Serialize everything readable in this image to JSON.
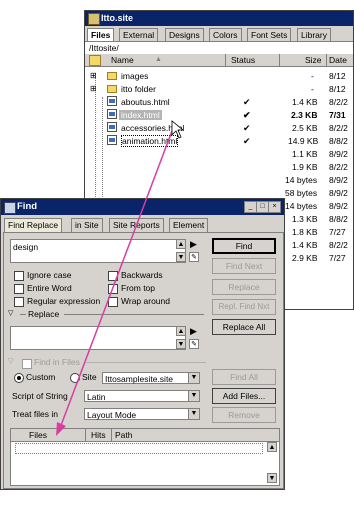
{
  "site_window": {
    "title": "Itto.site",
    "tabs": [
      "Files",
      "External",
      "Designs",
      "Colors",
      "Font Sets",
      "Library"
    ],
    "path": "/Ittosite/",
    "columns": {
      "name": "Name",
      "status": "Status",
      "size": "Size",
      "date": "Date"
    },
    "rows": [
      {
        "name": "images",
        "type": "folder",
        "status": "",
        "size": "-",
        "date": "8/12"
      },
      {
        "name": "itto folder",
        "type": "folder",
        "status": "",
        "size": "-",
        "date": "8/12"
      },
      {
        "name": "aboutus.html",
        "type": "html",
        "status": "✔",
        "size": "1.4 KB",
        "date": "8/2/2"
      },
      {
        "name": "index.html",
        "type": "html",
        "status": "✔",
        "size": "2.3 KB",
        "date": "7/31"
      },
      {
        "name": "accessories.html",
        "type": "html",
        "status": "✔",
        "size": "2.5 KB",
        "date": "8/2/2"
      },
      {
        "name": "animation.html",
        "type": "html",
        "status": "✔",
        "size": "14.9 KB",
        "date": "8/8/2"
      },
      {
        "name": "",
        "type": "",
        "status": "",
        "size": "1.1 KB",
        "date": "8/9/2"
      },
      {
        "name": "",
        "type": "",
        "status": "",
        "size": "1.9 KB",
        "date": "8/2/2"
      },
      {
        "name": "",
        "type": "",
        "status": "",
        "size": "14 bytes",
        "date": "8/9/2"
      },
      {
        "name": "",
        "type": "",
        "status": "",
        "size": "58 bytes",
        "date": "8/9/2"
      },
      {
        "name": "",
        "type": "",
        "status": "",
        "size": "14 bytes",
        "date": "8/9/2"
      },
      {
        "name": "",
        "type": "",
        "status": "",
        "size": "1.3 KB",
        "date": "8/8/2"
      },
      {
        "name": "",
        "type": "",
        "status": "",
        "size": "1.8 KB",
        "date": "7/27"
      },
      {
        "name": "",
        "type": "",
        "status": "",
        "size": "1.4 KB",
        "date": "8/2/2"
      },
      {
        "name": "",
        "type": "",
        "status": "",
        "size": "2.9 KB",
        "date": "7/27"
      }
    ]
  },
  "find_dialog": {
    "title": "Find",
    "tabs": [
      "Find Replace",
      "in Site",
      "Site Reports",
      "Element"
    ],
    "find_value": "design",
    "buttons": {
      "find": "Find",
      "find_next": "Find Next",
      "replace": "Replace",
      "repl_find_nxt": "Repl. Find Nxt",
      "replace_all": "Replace All",
      "find_all": "Find All",
      "add_files": "Add Files...",
      "remove": "Remove"
    },
    "options": {
      "ignore_case": "Ignore case",
      "backwards": "Backwards",
      "entire_word": "Entire Word",
      "from_top": "From top",
      "regular_expression": "Regular expression",
      "wrap_around": "Wrap around"
    },
    "replace_label": "Replace",
    "find_in_files_label": "Find in Files",
    "scope": {
      "custom": "Custom",
      "site": "Site",
      "site_value": "Ittosamplesite.site"
    },
    "script_label": "Script of String",
    "script_value": "Latin",
    "treat_label": "Treat files in",
    "treat_value": "Layout Mode",
    "results_columns": {
      "files": "Files",
      "hits": "Hits",
      "path": "Path"
    }
  },
  "colors": {
    "title_bar": "#0a246a",
    "window_bg": "#d6d3ce",
    "arrow": "#d63fa0"
  }
}
